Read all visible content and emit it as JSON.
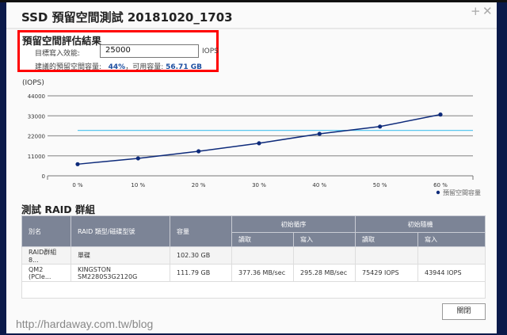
{
  "window": {
    "title": "SSD 預留空間測試 20181020_1703",
    "maximize_icon": "plus-icon",
    "close_icon": "close-icon"
  },
  "estimate": {
    "title": "預留空間評估結果",
    "target_label": "目標寫入效能:",
    "target_value": "25000",
    "target_unit": "IOPS",
    "suggest_label": "建議的預留空間容量:",
    "suggest_percent": "44%",
    "suggest_sep": "，可用容量:",
    "suggest_capacity": "56.71 GB"
  },
  "chart_data": {
    "type": "line",
    "ylabel": "(IOPS)",
    "categories": [
      "0 %",
      "10 %",
      "20 %",
      "30 %",
      "40 %",
      "50 %",
      "60 %"
    ],
    "yticks": [
      "0",
      "11000",
      "22000",
      "33000",
      "44000"
    ],
    "ylim": [
      0,
      44000
    ],
    "series": [
      {
        "name": "預留空間容量",
        "values": [
          6400,
          9600,
          13500,
          17900,
          23100,
          27100,
          33700
        ],
        "color": "#0d2a7a"
      }
    ],
    "target_line": {
      "value": 25000,
      "color": "#5ac8f0"
    },
    "grid": true,
    "legend": "bottom-right"
  },
  "raid": {
    "title": "測試 RAID 群組",
    "headers": {
      "alias": "別名",
      "type": "RAID 類型/磁碟型號",
      "capacity": "容量",
      "seq": "初始循序",
      "rand": "初始隨機",
      "read": "讀取",
      "write": "寫入"
    },
    "rows": [
      [
        "RAID群組 8...",
        "單碟",
        "102.30 GB",
        "",
        "",
        "",
        ""
      ],
      [
        "QM2 (PCIe...",
        "KINGSTON SM2280S3G2120G",
        "111.79 GB",
        "377.36 MB/sec",
        "295.28 MB/sec",
        "75429 IOPS",
        "43944 IOPS"
      ]
    ]
  },
  "footer": {
    "close_label": "關閉"
  },
  "watermark": "http://hardaway.com.tw/blog"
}
